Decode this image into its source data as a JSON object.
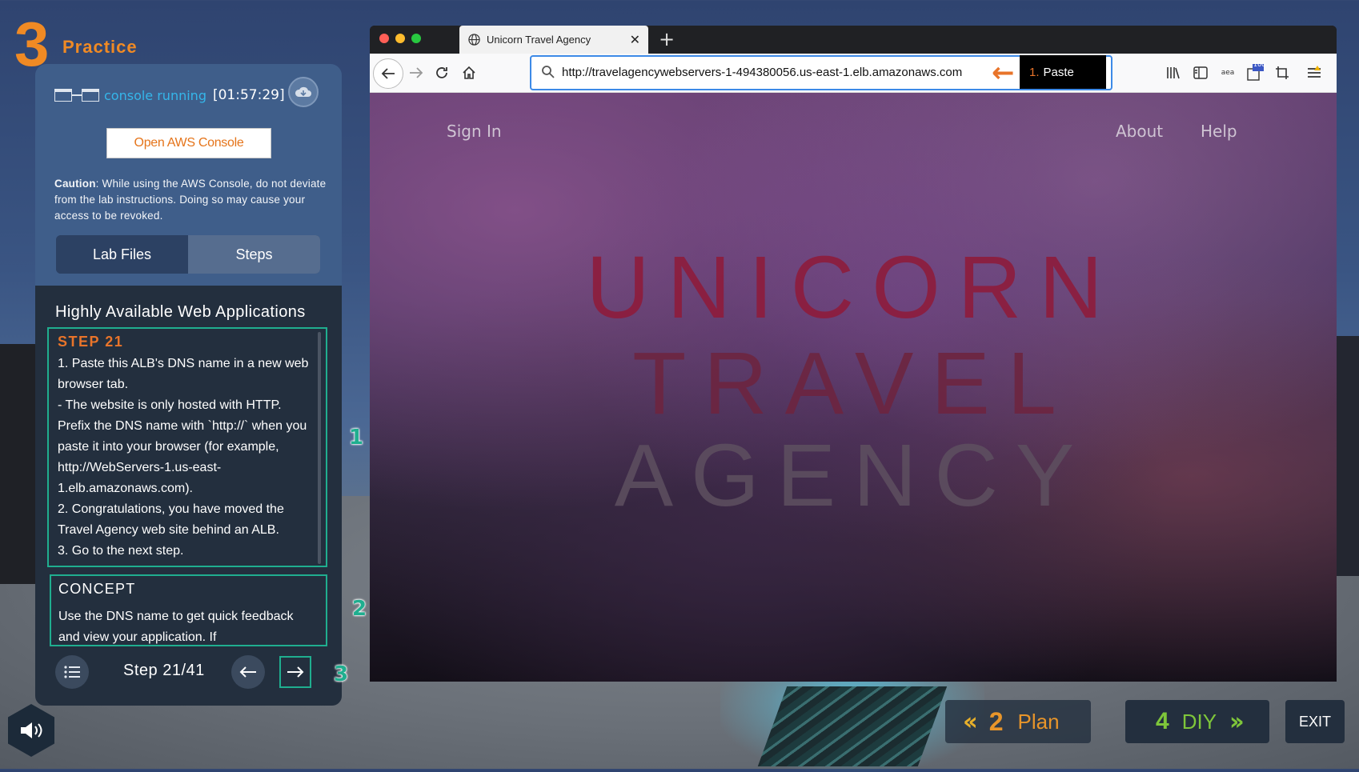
{
  "practice": {
    "number": "3",
    "label": "Practice"
  },
  "console": {
    "status": "console running",
    "timer": "[01:57:29]",
    "open_button": "Open AWS Console",
    "caution_label": "Caution",
    "caution_text": ": While using the AWS Console, do not deviate from the lab instructions. Doing so may cause your access to be revoked."
  },
  "tabs": [
    "Lab Files",
    "Steps"
  ],
  "lab": {
    "title": "Highly Available Web Applications",
    "step": {
      "heading": "STEP 21",
      "lines": [
        "1. Paste this ALB's DNS name in a new web browser tab.",
        "- The website is only hosted with HTTP. Prefix the DNS name with `http://` when you paste it into your browser (for example, http://WebServers-1.us-east-1.elb.amazonaws.com).",
        "2. Congratulations, you have moved the Travel Agency web site behind an ALB.",
        "3. Go to the next step."
      ]
    },
    "concept": {
      "heading": "CONCEPT",
      "text": "Use the DNS name to get quick feedback and view your application.  If"
    },
    "step_counter": "Step 21/41",
    "markers": [
      "1",
      "2",
      "3"
    ]
  },
  "browser": {
    "tab_title": "Unicorn Travel Agency",
    "url": "http://travelagencywebservers-1-494380056.us-east-1.elb.amazonaws.com",
    "paste_tip_number": "1.",
    "paste_tip_label": "Paste",
    "badge_count": "100",
    "amazon_label": "aea"
  },
  "site": {
    "sign_in": "Sign In",
    "about": "About",
    "help": "Help",
    "hero": [
      "UNICORN",
      "TRAVEL",
      "AGENCY"
    ]
  },
  "bottom_nav": {
    "plan_number": "2",
    "plan_label": "Plan",
    "diy_number": "4",
    "diy_label": "DIY",
    "exit": "EXIT"
  },
  "colors": {
    "accent_orange": "#e8742a",
    "teal": "#1fae8f",
    "console_blue": "#35b6ea",
    "diy_green": "#7ec63a"
  }
}
